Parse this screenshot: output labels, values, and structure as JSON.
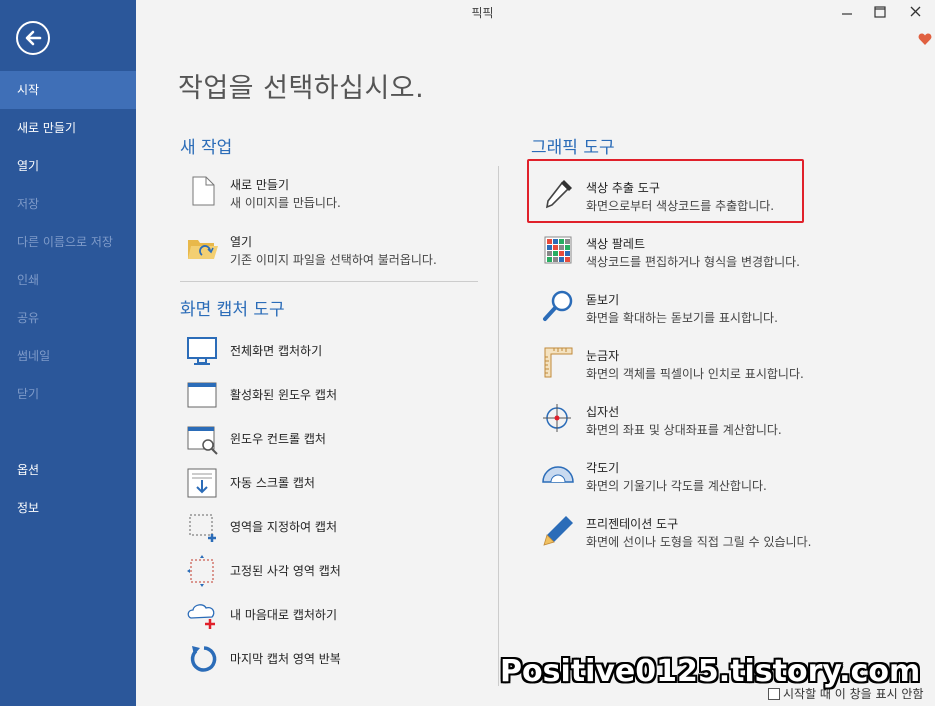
{
  "window": {
    "title": "픽픽"
  },
  "colors": {
    "sidebar": "#2b579a",
    "sidebar_active": "#3f6fb7",
    "accent": "#2b6cb8",
    "highlight": "#e0202a"
  },
  "sidebar": {
    "back_icon": "back-arrow-icon",
    "items": [
      {
        "label": "시작",
        "state": "active"
      },
      {
        "label": "새로 만들기",
        "state": "normal"
      },
      {
        "label": "열기",
        "state": "normal"
      },
      {
        "label": "저장",
        "state": "disabled"
      },
      {
        "label": "다른 이름으로 저장",
        "state": "disabled"
      },
      {
        "label": "인쇄",
        "state": "disabled"
      },
      {
        "label": "공유",
        "state": "disabled"
      },
      {
        "label": "썸네일",
        "state": "disabled"
      },
      {
        "label": "닫기",
        "state": "disabled"
      },
      {
        "label": "옵션",
        "state": "normal"
      },
      {
        "label": "정보",
        "state": "normal"
      }
    ]
  },
  "main": {
    "heading": "작업을 선택하십시오.",
    "new_task": {
      "title": "새 작업",
      "items": [
        {
          "name": "새로 만들기",
          "desc": "새 이미지를 만듭니다.",
          "icon": "blank-document-icon"
        },
        {
          "name": "열기",
          "desc": "기존 이미지 파일을 선택하여 불러옵니다.",
          "icon": "open-folder-icon"
        }
      ]
    },
    "capture": {
      "title": "화면 캡처 도구",
      "items": [
        {
          "name": "전체화면 캡처하기",
          "icon": "monitor-icon"
        },
        {
          "name": "활성화된 윈도우 캡처",
          "icon": "active-window-icon"
        },
        {
          "name": "윈도우 컨트롤 캡처",
          "icon": "window-control-icon"
        },
        {
          "name": "자동 스크롤 캡처",
          "icon": "scroll-capture-icon"
        },
        {
          "name": "영역을 지정하여 캡처",
          "icon": "region-capture-icon"
        },
        {
          "name": "고정된 사각 영역 캡처",
          "icon": "fixed-region-icon"
        },
        {
          "name": "내 마음대로 캡처하기",
          "icon": "freeform-capture-icon"
        },
        {
          "name": "마지막 캡처 영역 반복",
          "icon": "repeat-capture-icon"
        }
      ]
    },
    "graphics": {
      "title": "그래픽 도구",
      "items": [
        {
          "name": "색상 추출 도구",
          "desc": "화면으로부터 색상코드를 추출합니다.",
          "icon": "eyedropper-icon"
        },
        {
          "name": "색상 팔레트",
          "desc": "색상코드를 편집하거나 형식을 변경합니다.",
          "icon": "palette-icon"
        },
        {
          "name": "돋보기",
          "desc": "화면을 확대하는 돋보기를 표시합니다.",
          "icon": "magnifier-icon"
        },
        {
          "name": "눈금자",
          "desc": "화면의 객체를 픽셀이나 인치로 표시합니다.",
          "icon": "ruler-icon"
        },
        {
          "name": "십자선",
          "desc": "화면의 좌표 및 상대좌표를 계산합니다.",
          "icon": "crosshair-icon"
        },
        {
          "name": "각도기",
          "desc": "화면의 기울기나 각도를 계산합니다.",
          "icon": "protractor-icon"
        },
        {
          "name": "프리젠테이션 도구",
          "desc": "화면에 선이나 도형을 직접 그릴 수 있습니다.",
          "icon": "pen-icon"
        }
      ]
    }
  },
  "footer": {
    "dont_show": "시작할 때 이 창을 표시 안함",
    "watermark": "Positive0125.tistory.com"
  }
}
